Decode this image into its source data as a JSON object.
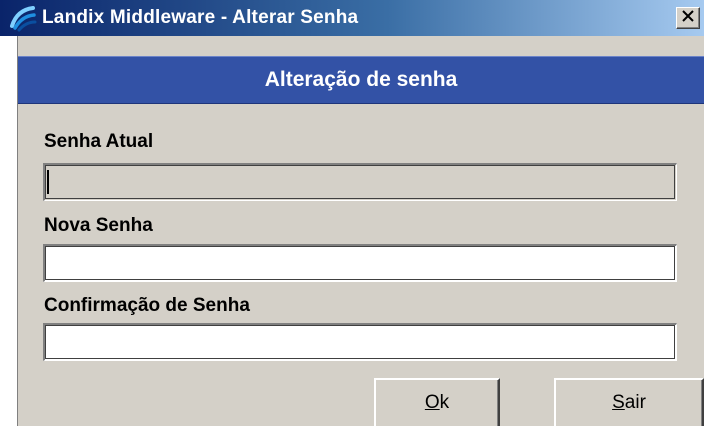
{
  "window": {
    "title": "Landix Middleware - Alterar Senha",
    "close_symbol": "×"
  },
  "header": {
    "title": "Alteração de senha"
  },
  "form": {
    "current_password": {
      "label": "Senha Atual",
      "value": "",
      "enabled": false
    },
    "new_password": {
      "label": "Nova Senha",
      "value": ""
    },
    "confirm_password": {
      "label": "Confirmação de Senha",
      "value": ""
    }
  },
  "buttons": {
    "ok": {
      "accel": "O",
      "rest": "k"
    },
    "exit": {
      "accel": "S",
      "rest": "air"
    }
  },
  "colors": {
    "titlebar_start": "#0a246a",
    "titlebar_end": "#a6caf0",
    "header_band": "#3352a6",
    "dialog_face": "#d4d0c8"
  },
  "icons": {
    "app": "landix-app-icon",
    "close": "close-icon"
  }
}
